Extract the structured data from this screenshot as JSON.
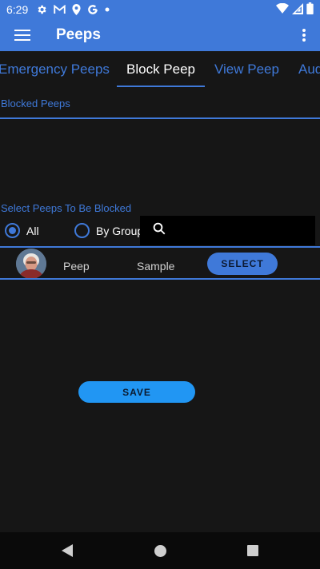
{
  "status_bar": {
    "time": "6:29",
    "left_icons": [
      "settings-icon",
      "gmail-icon",
      "location-icon",
      "google-icon",
      "dot-icon"
    ],
    "right_icons": [
      "wifi-icon",
      "signal-icon",
      "battery-icon"
    ]
  },
  "app_bar": {
    "title": "Peeps",
    "menu_icon": "hamburger-menu-icon",
    "overflow_icon": "more-vertical-icon"
  },
  "tabs": [
    {
      "label": "Emergency Peeps",
      "active": false
    },
    {
      "label": "Block Peep",
      "active": true
    },
    {
      "label": "View Peep",
      "active": false
    },
    {
      "label": "Aud",
      "active": false
    }
  ],
  "blocked_section": {
    "label": "Blocked Peeps"
  },
  "select_section": {
    "label": "Select Peeps To Be Blocked",
    "radio_all": "All",
    "radio_group": "By Group",
    "selected": "All",
    "search_placeholder": ""
  },
  "peep_row": {
    "first_name": "Peep",
    "last_name": "Sample",
    "select_label": "SELECT"
  },
  "save_label": "SAVE",
  "colors": {
    "accent": "#3f79d9",
    "background": "#161616",
    "save_button": "#2196f3"
  }
}
